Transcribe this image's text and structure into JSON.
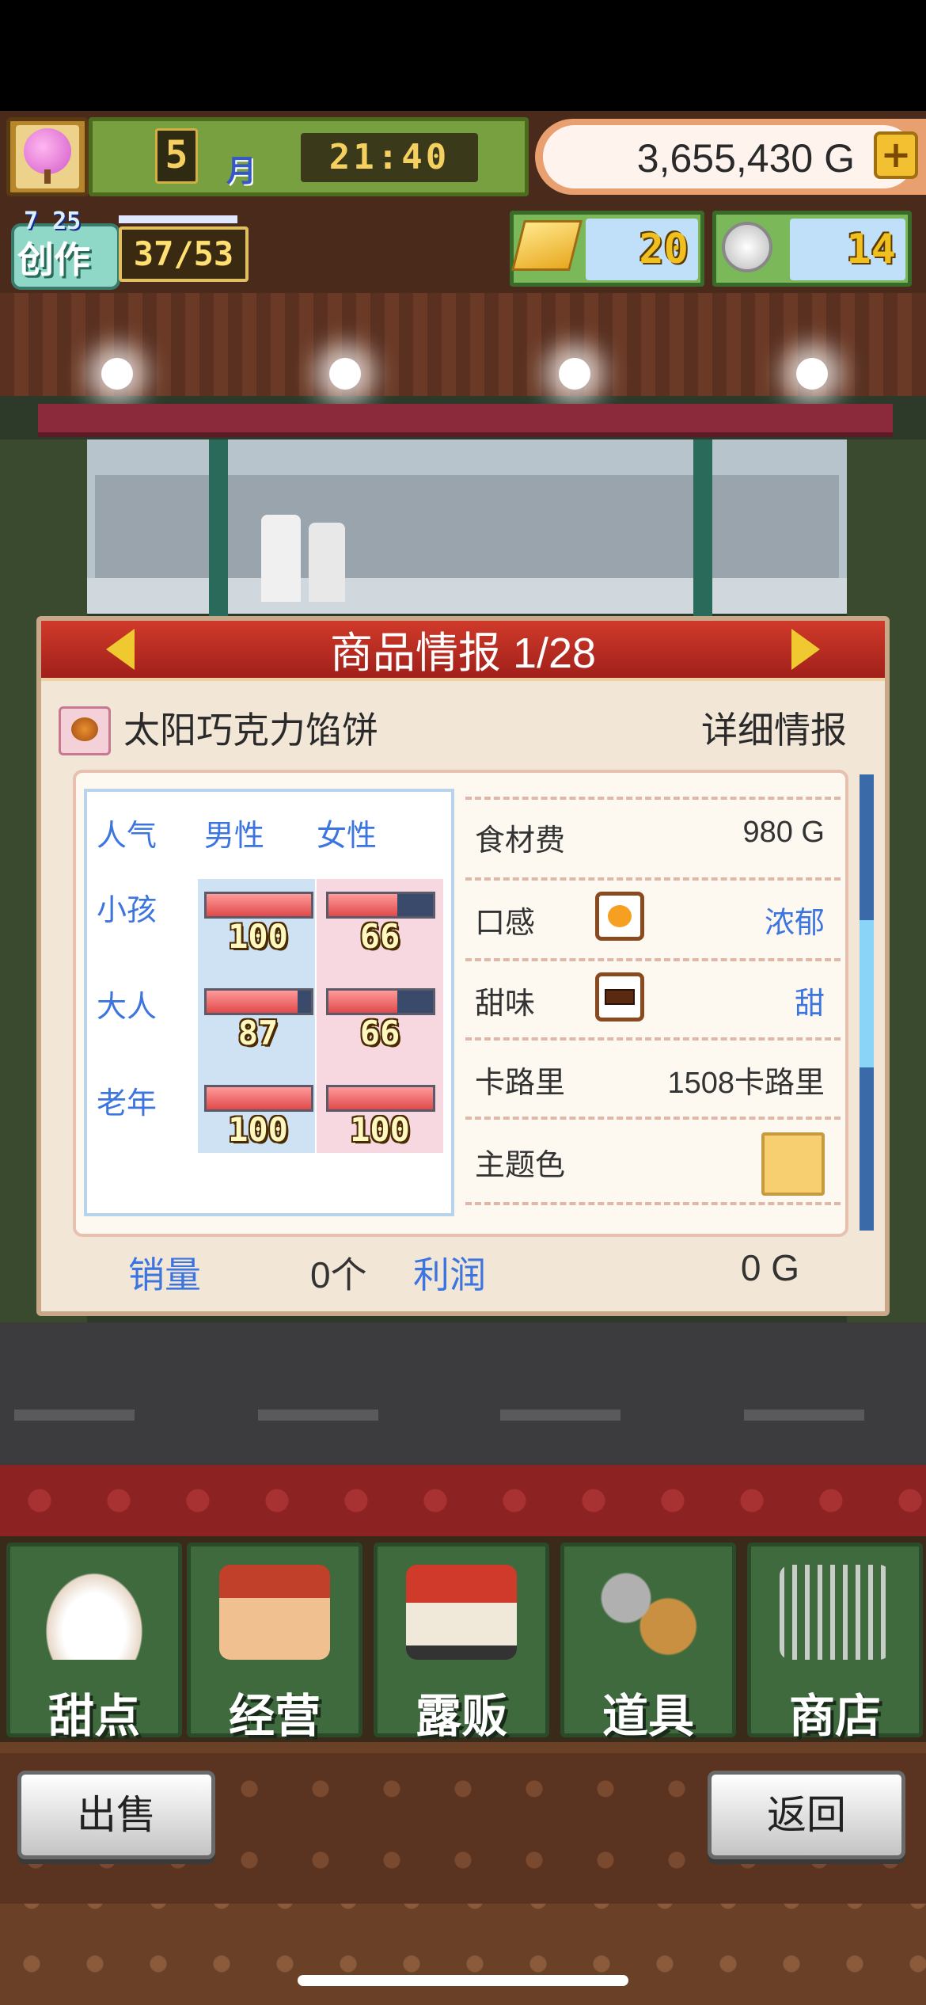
{
  "hud": {
    "month_num": "5",
    "month_label": "月",
    "time": "21:40",
    "gold": "3,655,430 G",
    "plus": "+",
    "create_small": "7 25",
    "create_label": "创作",
    "create_count": "37/53",
    "ingots": "20",
    "coins": "14"
  },
  "dialog": {
    "title": "商品情报 1/28",
    "product_name": "太阳巧克力馅饼",
    "detail_button": "详细情报",
    "popularity": {
      "header": "人气",
      "col_male": "男性",
      "col_female": "女性",
      "rows": [
        {
          "label": "小孩",
          "male": 100,
          "female": 66
        },
        {
          "label": "大人",
          "male": 87,
          "female": 66
        },
        {
          "label": "老年",
          "male": 100,
          "female": 100
        }
      ]
    },
    "info": {
      "ingredient_label": "食材费",
      "ingredient_value": "980 G",
      "texture_label": "口感",
      "texture_value": "浓郁",
      "sweetness_label": "甜味",
      "sweetness_value": "甜",
      "calorie_label": "卡路里",
      "calorie_value": "1508卡路里",
      "theme_label": "主题色",
      "theme_color": "#f8cf70"
    },
    "footer": {
      "sales_label": "销量",
      "sales_value": "0个",
      "profit_label": "利润",
      "profit_value": "0 G"
    }
  },
  "tabs": [
    {
      "label": "甜点",
      "icon": "cake-icon"
    },
    {
      "label": "经营",
      "icon": "shop-icon"
    },
    {
      "label": "露贩",
      "icon": "truck-icon"
    },
    {
      "label": "道具",
      "icon": "tools-bag-icon"
    },
    {
      "label": "商店",
      "icon": "cart-icon"
    }
  ],
  "buttons": {
    "sell": "出售",
    "back": "返回"
  }
}
